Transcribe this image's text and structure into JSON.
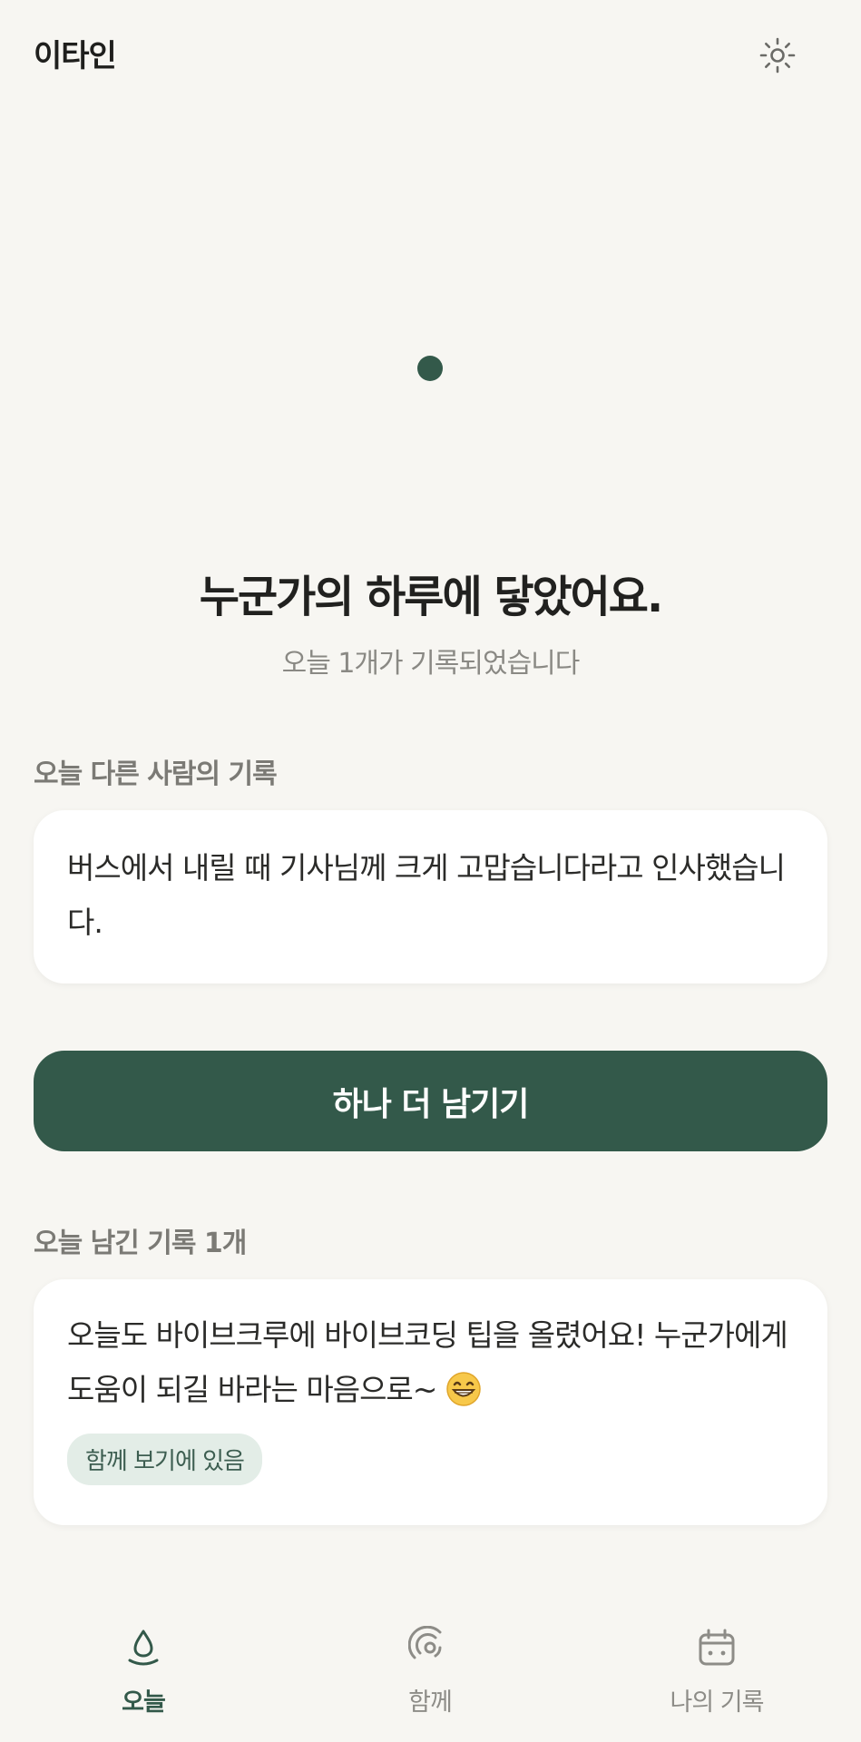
{
  "header": {
    "app_title": "이타인",
    "theme_icon": "sun-icon"
  },
  "hero": {
    "title": "누군가의 하루에 닿았어요.",
    "subtitle": "오늘 1개가 기록되었습니다"
  },
  "others_section": {
    "label": "오늘 다른 사람의 기록",
    "record_text": "버스에서 내릴 때 기사님께 크게 고맙습니다라고 인사했습니다."
  },
  "primary_button": {
    "label": "하나 더 남기기"
  },
  "my_section": {
    "label": "오늘 남긴 기록 1개",
    "record_text": "오늘도 바이브크루에 바이브코딩 팁을 올렸어요! 누군가에게 도움이 되길 바라는 마음으로~",
    "emoji": "😁",
    "tag": "함께 보기에 있음"
  },
  "bottom_nav": {
    "items": [
      {
        "label": "오늘",
        "icon": "drop-icon",
        "active": true
      },
      {
        "label": "함께",
        "icon": "signal-icon",
        "active": false
      },
      {
        "label": "나의 기록",
        "icon": "calendar-icon",
        "active": false
      }
    ]
  },
  "colors": {
    "background": "#f7f6f2",
    "accent": "#33594a",
    "tag_background": "#e3ede7",
    "muted_text": "#8a8984"
  }
}
